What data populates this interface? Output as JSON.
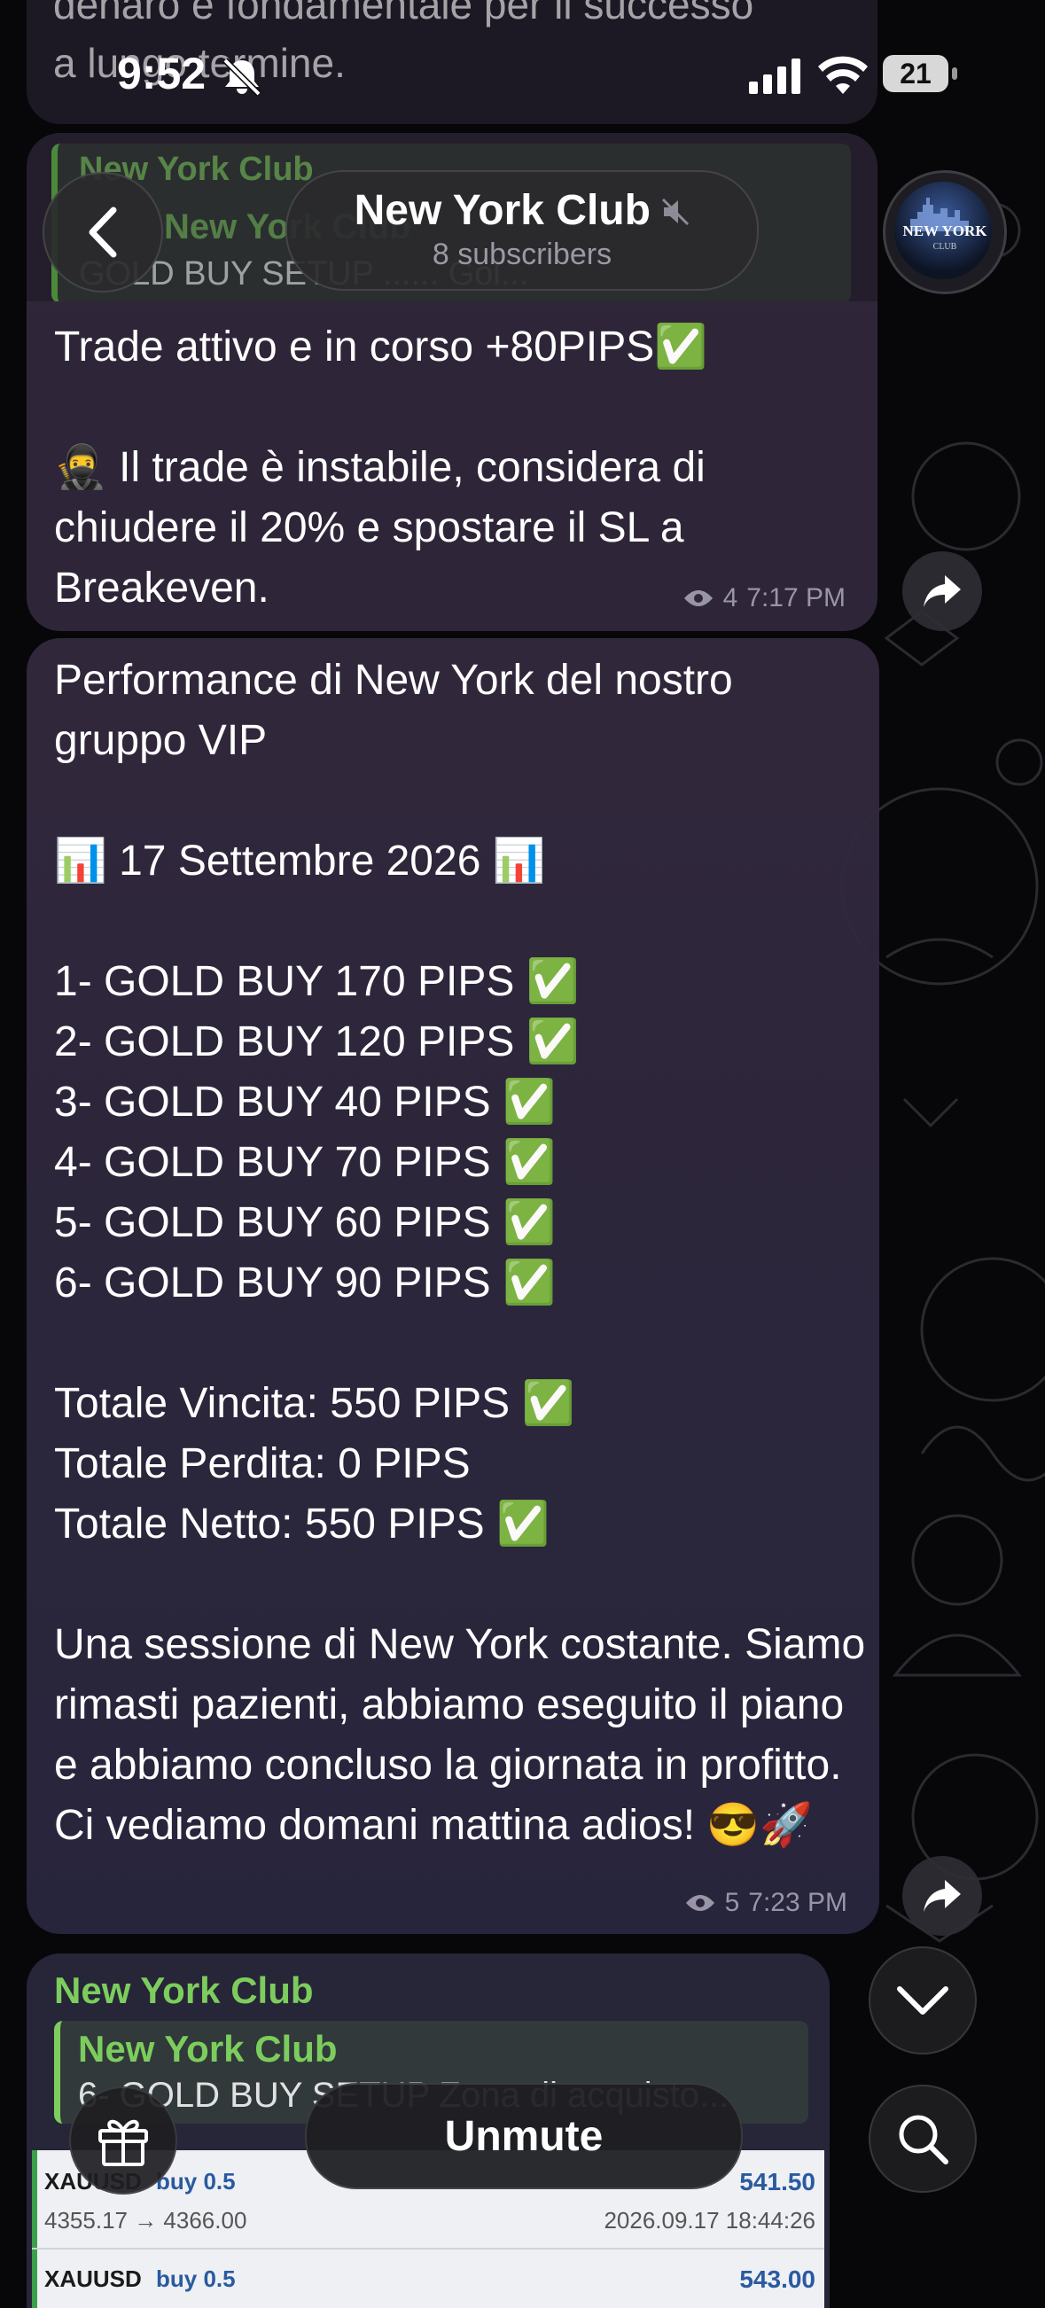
{
  "status_bar": {
    "time": "9:52",
    "battery": "21"
  },
  "header": {
    "title": "New York Club",
    "subtitle": "8 subscribers",
    "avatar_text_1": "NEW YORK",
    "avatar_text_2": "CLUB"
  },
  "top_ghost": {
    "line1": "denaro è fondamentale per il successo",
    "line2": "a lungo termine.",
    "reply_name": "New York Club",
    "reply_text": "GOLD BUY SETUP ...... Gol..."
  },
  "messages": [
    {
      "text": "Trade attivo e in corso +80PIPS✅\n\n🥷 Il trade è instabile, considera di chiudere il 20% e spostare il SL a Breakeven.",
      "views": "4",
      "time": "7:17 PM"
    },
    {
      "text": "Performance di New York del nostro gruppo VIP\n\n📊 17 Settembre 2026 📊\n\n1- GOLD BUY 170 PIPS ✅\n2- GOLD BUY 120 PIPS ✅\n3- GOLD BUY 40 PIPS ✅\n4- GOLD BUY 70 PIPS ✅\n5- GOLD BUY 60 PIPS ✅\n6- GOLD BUY 90 PIPS ✅\n\nTotale Vincita: 550 PIPS ✅\nTotale Perdita: 0 PIPS\nTotale Netto: 550 PIPS ✅\n\nUna sessione di New York costante. Siamo rimasti pazienti, abbiamo eseguito il piano e abbiamo concluso la giornata in profitto. Ci vediamo domani mattina adios! 😎🚀",
      "views": "5",
      "time": "7:23 PM"
    },
    {
      "sender": "New York Club",
      "reply_name": "New York Club",
      "reply_text": "6- GOLD BUY SETUP Zona di acquisto...",
      "trade": {
        "symbol": "XAUUSD",
        "side": "buy 0.5",
        "profit": "541.50",
        "prices": "4355.17 → 4366.00",
        "datetime": "2026.09.17 18:44:26",
        "symbol2": "XAUUSD",
        "side2": "buy 0.5",
        "profit2": "543.00"
      }
    }
  ],
  "bottom": {
    "unmute_label": "Unmute"
  },
  "colors": {
    "bubble": "#30283a",
    "accent_green": "#7ccd5d",
    "trade_blue": "#2a5aa0"
  }
}
